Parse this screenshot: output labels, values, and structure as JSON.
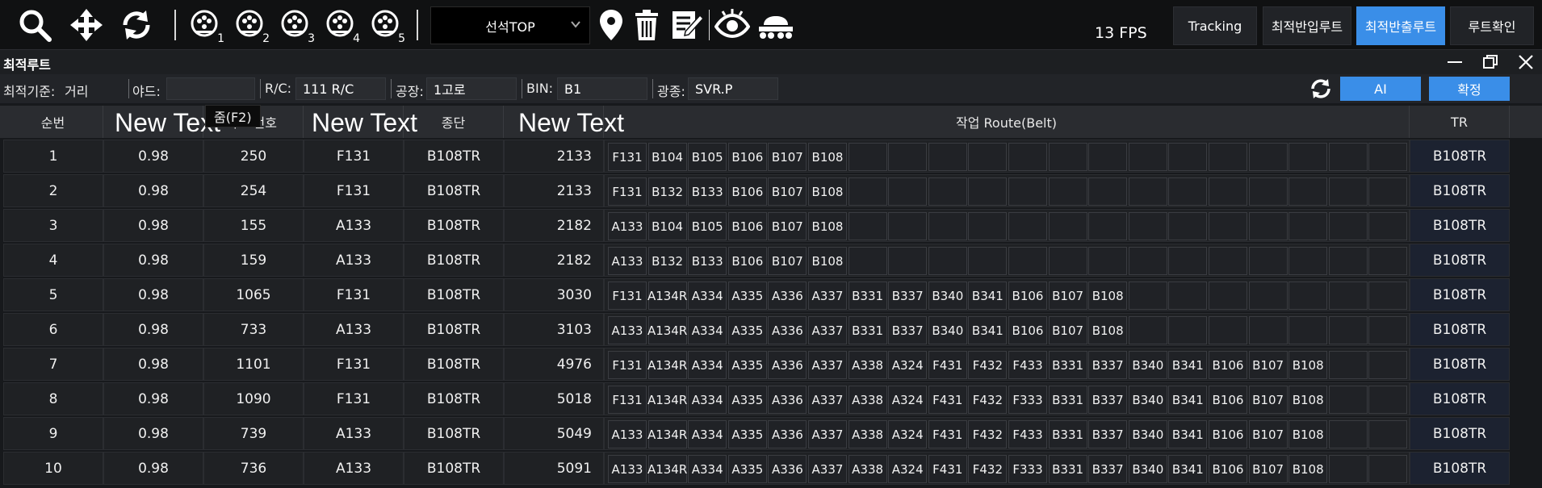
{
  "toolbar": {
    "icons": [
      "search-icon",
      "move-icon",
      "refresh-icon",
      "zoom-preset-icon",
      "location-pin-icon",
      "trash-icon",
      "edit-note-icon",
      "eye-icon",
      "crane-vehicle-icon"
    ],
    "presets": [
      "1",
      "2",
      "3",
      "4",
      "5"
    ],
    "select_value": "선석TOP",
    "fps": "13 FPS",
    "buttons": {
      "tracking": "Tracking",
      "inbound_route": "최적반입루트",
      "outbound_route": "최적반출루트",
      "route_confirm": "루트확인"
    }
  },
  "panel": {
    "title": "최적루트",
    "tooltip": "줌(F2)"
  },
  "filters": {
    "criterion_label": "최적기준:",
    "criterion_value": "거리",
    "yard_label": "야드:",
    "yard_value": "",
    "rc_label": "R/C:",
    "rc_value": "111 R/C",
    "factory_label": "공장:",
    "factory_value": "1고로",
    "bin_label": "BIN:",
    "bin_value": "B1",
    "ore_label": "광종:",
    "ore_value": "SVR.P",
    "ai_button": "AI",
    "confirm_button": "확정"
  },
  "table": {
    "headers": [
      "순번",
      "",
      "루트번호",
      "",
      "종단",
      "",
      "작업 Route(Belt)",
      "TR"
    ],
    "overlay_text": "New Text",
    "rows": [
      {
        "no": "1",
        "score": "0.98",
        "route": "250",
        "start": "F131",
        "end": "B108TR",
        "dist": "2133",
        "belts": [
          "F131",
          "B104",
          "B105",
          "B106",
          "B107",
          "B108"
        ],
        "tr": "B108TR"
      },
      {
        "no": "2",
        "score": "0.98",
        "route": "254",
        "start": "F131",
        "end": "B108TR",
        "dist": "2133",
        "belts": [
          "F131",
          "B132",
          "B133",
          "B106",
          "B107",
          "B108"
        ],
        "tr": "B108TR"
      },
      {
        "no": "3",
        "score": "0.98",
        "route": "155",
        "start": "A133",
        "end": "B108TR",
        "dist": "2182",
        "belts": [
          "A133",
          "B104",
          "B105",
          "B106",
          "B107",
          "B108"
        ],
        "tr": "B108TR"
      },
      {
        "no": "4",
        "score": "0.98",
        "route": "159",
        "start": "A133",
        "end": "B108TR",
        "dist": "2182",
        "belts": [
          "A133",
          "B132",
          "B133",
          "B106",
          "B107",
          "B108"
        ],
        "tr": "B108TR"
      },
      {
        "no": "5",
        "score": "0.98",
        "route": "1065",
        "start": "F131",
        "end": "B108TR",
        "dist": "3030",
        "belts": [
          "F131",
          "A134R",
          "A334",
          "A335",
          "A336",
          "A337",
          "B331",
          "B337",
          "B340",
          "B341",
          "B106",
          "B107",
          "B108"
        ],
        "tr": "B108TR"
      },
      {
        "no": "6",
        "score": "0.98",
        "route": "733",
        "start": "A133",
        "end": "B108TR",
        "dist": "3103",
        "belts": [
          "A133",
          "A134R",
          "A334",
          "A335",
          "A336",
          "A337",
          "B331",
          "B337",
          "B340",
          "B341",
          "B106",
          "B107",
          "B108"
        ],
        "tr": "B108TR"
      },
      {
        "no": "7",
        "score": "0.98",
        "route": "1101",
        "start": "F131",
        "end": "B108TR",
        "dist": "4976",
        "belts": [
          "F131",
          "A134R",
          "A334",
          "A335",
          "A336",
          "A337",
          "A338",
          "A324",
          "F431",
          "F432",
          "F433",
          "B331",
          "B337",
          "B340",
          "B341",
          "B106",
          "B107",
          "B108"
        ],
        "tr": "B108TR"
      },
      {
        "no": "8",
        "score": "0.98",
        "route": "1090",
        "start": "F131",
        "end": "B108TR",
        "dist": "5018",
        "belts": [
          "F131",
          "A134R",
          "A334",
          "A335",
          "A336",
          "A337",
          "A338",
          "A324",
          "F431",
          "F432",
          "F333",
          "B331",
          "B337",
          "B340",
          "B341",
          "B106",
          "B107",
          "B108"
        ],
        "tr": "B108TR"
      },
      {
        "no": "9",
        "score": "0.98",
        "route": "739",
        "start": "A133",
        "end": "B108TR",
        "dist": "5049",
        "belts": [
          "A133",
          "A134R",
          "A334",
          "A335",
          "A336",
          "A337",
          "A338",
          "A324",
          "F431",
          "F432",
          "F433",
          "B331",
          "B337",
          "B340",
          "B341",
          "B106",
          "B107",
          "B108"
        ],
        "tr": "B108TR"
      },
      {
        "no": "10",
        "score": "0.98",
        "route": "736",
        "start": "A133",
        "end": "B108TR",
        "dist": "5091",
        "belts": [
          "A133",
          "A134R",
          "A334",
          "A335",
          "A336",
          "A337",
          "A338",
          "A324",
          "F431",
          "F432",
          "F333",
          "B331",
          "B337",
          "B340",
          "B341",
          "B106",
          "B107",
          "B108"
        ],
        "tr": "B108TR"
      }
    ]
  },
  "colors": {
    "accent": "#3a8ee8",
    "toolbar_bg": "#101112",
    "cell_bg": "#1f2124"
  }
}
